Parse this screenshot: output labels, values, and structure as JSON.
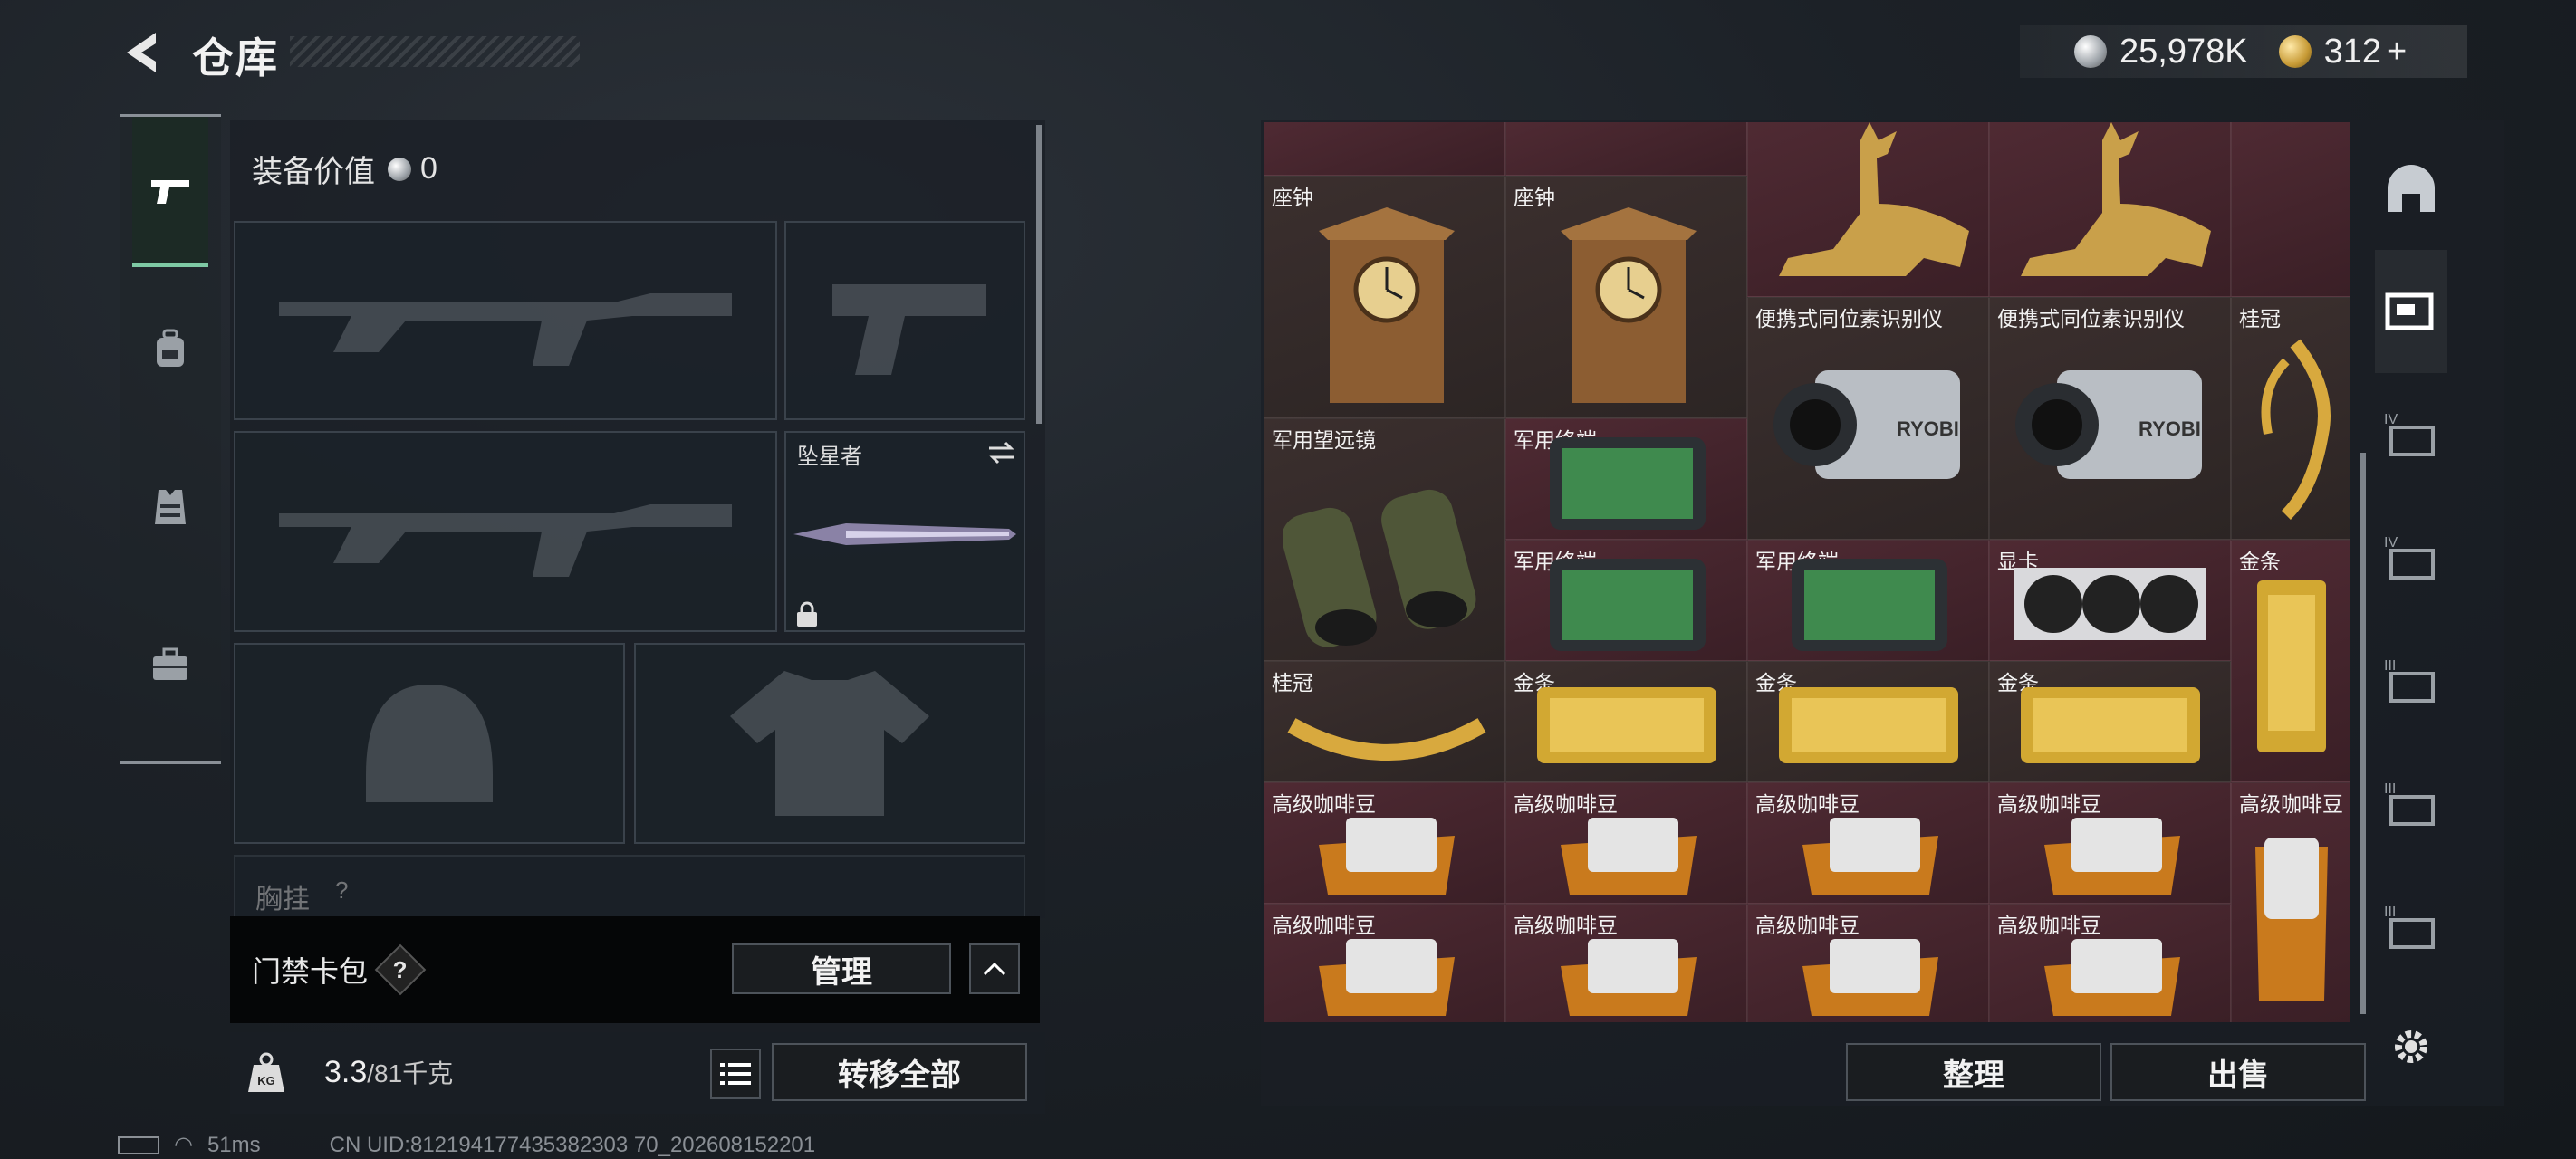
{
  "header": {
    "title": "仓库",
    "silver": "25,978K",
    "gold": "312",
    "gold_plus": "+"
  },
  "left_tabs": [
    {
      "name": "weapons"
    },
    {
      "name": "backpack"
    },
    {
      "name": "vest"
    },
    {
      "name": "case"
    }
  ],
  "equipment": {
    "value_label": "装备价值",
    "value": "0",
    "sniper_label": "坠星者",
    "chest_label": "胸挂",
    "chest_q": "?"
  },
  "gate": {
    "label": "门禁卡包",
    "help": "?",
    "manage": "管理"
  },
  "weight": {
    "current": "3.3",
    "max": "/81千克",
    "transfer_all": "转移全部"
  },
  "stash": {
    "items": [
      {
        "label": "座钟"
      },
      {
        "label": "座钟"
      },
      {
        "label": "便携式同位素识别仪"
      },
      {
        "label": "便携式同位素识别仪"
      },
      {
        "label": "桂冠"
      },
      {
        "label": "军用望远镜"
      },
      {
        "label": "军用终端"
      },
      {
        "label": "军用终端"
      },
      {
        "label": "军用终端"
      },
      {
        "label": "显卡"
      },
      {
        "label": "金条"
      },
      {
        "label": "桂冠"
      },
      {
        "label": "金条"
      },
      {
        "label": "金条"
      },
      {
        "label": "金条"
      },
      {
        "label": "高级咖啡豆"
      },
      {
        "label": "高级咖啡豆"
      },
      {
        "label": "高级咖啡豆"
      },
      {
        "label": "高级咖啡豆"
      },
      {
        "label": "高级咖啡豆"
      },
      {
        "label": "高级咖啡豆"
      },
      {
        "label": "高级咖啡豆"
      },
      {
        "label": "高级咖啡豆"
      },
      {
        "label": "高级咖啡豆"
      }
    ],
    "sort": "整理",
    "sell": "出售"
  },
  "right_tabs": [
    {
      "icon": "stash-main-icon"
    },
    {
      "icon": "stash-sub-icon"
    },
    {
      "label": "IV"
    },
    {
      "label": "IV"
    },
    {
      "label": "III"
    },
    {
      "label": "III"
    },
    {
      "label": "III"
    }
  ],
  "status": {
    "ping": "51ms",
    "uid": "CN UID:812194177435382303 70_202608152201"
  },
  "colors": {
    "accent": "#7ec9a4",
    "rare_bg": "#4f2a33"
  }
}
